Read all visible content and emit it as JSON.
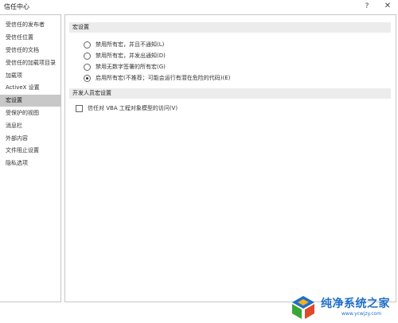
{
  "window": {
    "title": "信任中心",
    "help_glyph": "?",
    "close_glyph": "✕"
  },
  "sidebar": {
    "items": [
      {
        "label": "受信任的发布者",
        "selected": false
      },
      {
        "label": "受信任位置",
        "selected": false
      },
      {
        "label": "受信任的文档",
        "selected": false
      },
      {
        "label": "受信任的加载项目录",
        "selected": false
      },
      {
        "label": "加载项",
        "selected": false
      },
      {
        "label": "ActiveX 设置",
        "selected": false
      },
      {
        "label": "宏设置",
        "selected": true
      },
      {
        "label": "受保护的视图",
        "selected": false
      },
      {
        "label": "消息栏",
        "selected": false
      },
      {
        "label": "外部内容",
        "selected": false
      },
      {
        "label": "文件阻止设置",
        "selected": false
      },
      {
        "label": "隐私选项",
        "selected": false
      }
    ]
  },
  "macro_settings": {
    "header": "宏设置",
    "options": [
      {
        "label": "禁用所有宏，并且不通知(L)",
        "selected": false
      },
      {
        "label": "禁用所有宏，并发出通知(D)",
        "selected": false
      },
      {
        "label": "禁用无数字签署的所有宏(G)",
        "selected": false
      },
      {
        "label": "启用所有宏(不推荐；可能会运行有潜在危险的代码)(E)",
        "selected": true
      }
    ]
  },
  "developer_settings": {
    "header": "开发人员宏设置",
    "trust_vba_label": "信任对 VBA 工程对象模型的访问(V)",
    "trust_vba_checked": false
  },
  "watermark": {
    "text": "纯净系统之家",
    "url": "www.ycwjzy.com",
    "colors": {
      "blue": "#1e6fc9",
      "green": "#3aa635",
      "yellow": "#f2b01e",
      "red": "#e04a2a"
    }
  }
}
